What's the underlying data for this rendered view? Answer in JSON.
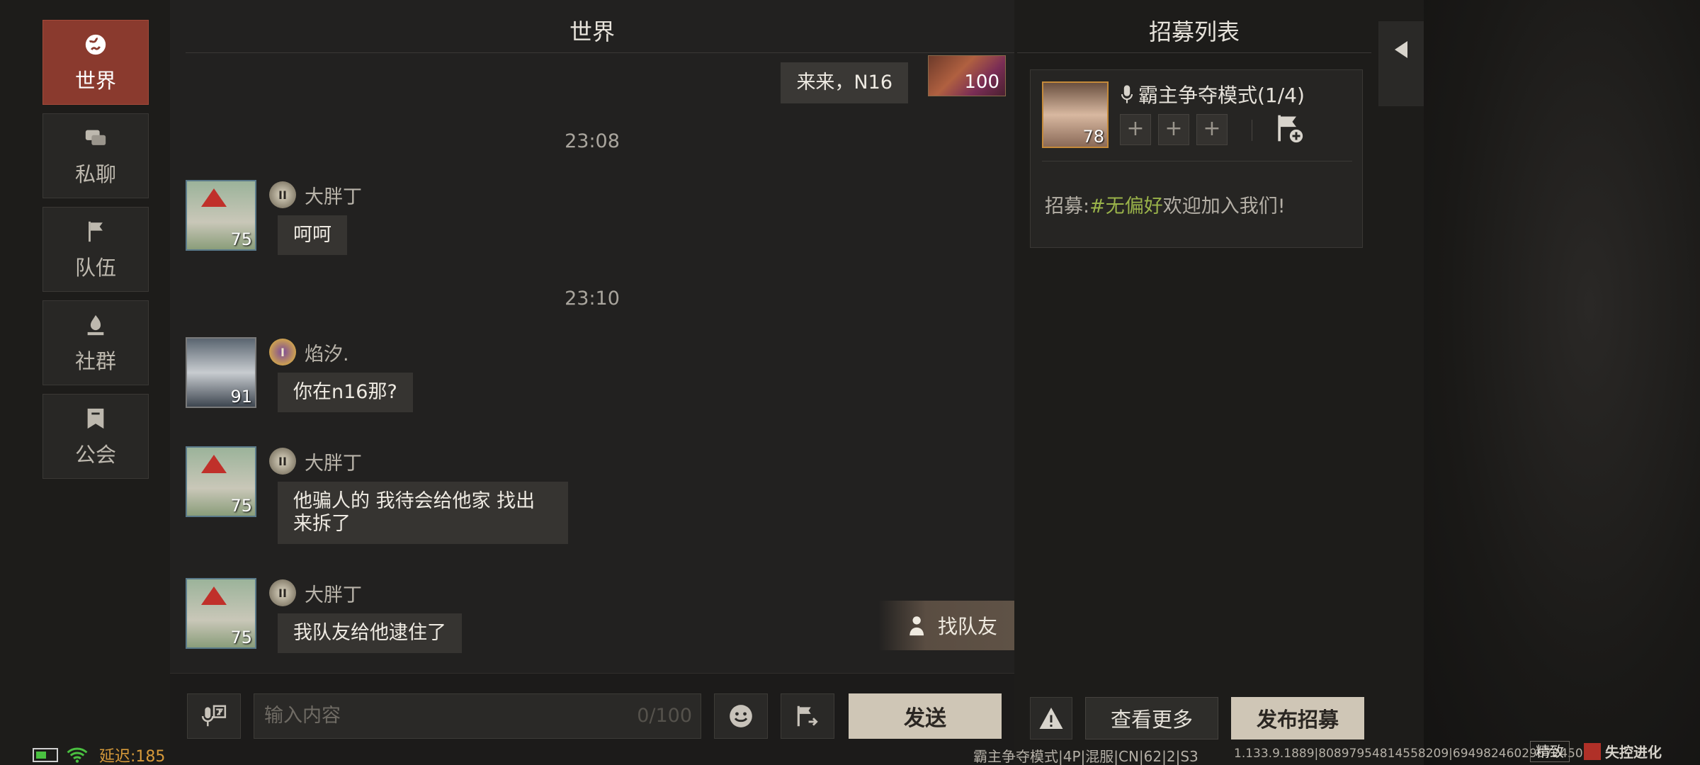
{
  "sidebar": {
    "items": [
      {
        "label": "世界",
        "icon": "globe-icon",
        "active": true
      },
      {
        "label": "私聊",
        "icon": "chat-bubbles-icon",
        "active": false
      },
      {
        "label": "队伍",
        "icon": "flag-icon",
        "active": false
      },
      {
        "label": "社群",
        "icon": "campfire-icon",
        "active": false
      },
      {
        "label": "公会",
        "icon": "guild-banner-icon",
        "active": false
      }
    ]
  },
  "chat": {
    "title": "世界",
    "self_message": {
      "text": "来来，N16",
      "level": "100"
    },
    "times": [
      "23:08",
      "23:10"
    ],
    "messages": [
      {
        "name": "大胖丁",
        "rank": "II",
        "level": "75",
        "text": "呵呵"
      },
      {
        "name": "焰汐.",
        "rank": "I",
        "level": "91",
        "text": "你在n16那?"
      },
      {
        "name": "大胖丁",
        "rank": "II",
        "level": "75",
        "text": "他骗人的 我待会给他家 找出来拆了"
      },
      {
        "name": "大胖丁",
        "rank": "II",
        "level": "75",
        "text": "我队友给他逮住了"
      }
    ],
    "find_team_label": "找队友",
    "input": {
      "placeholder": "输入内容",
      "count": "0/100"
    },
    "send_label": "发送"
  },
  "recruit": {
    "title": "招募列表",
    "card": {
      "mode": "霸主争夺模式(1/4)",
      "level": "78",
      "slots": [
        "+",
        "+",
        "+"
      ],
      "text_prefix": "招募:",
      "text_tag": "#无偏好",
      "text_suffix": "欢迎加入我们!"
    },
    "more_label": "查看更多",
    "post_label": "发布招募"
  },
  "status": {
    "latency": "延迟:185",
    "server": "霸主争夺模式|4P|混服|CN|62|2|S3",
    "version": "1.133.9.1889|80897954814558209|69498246029672450",
    "quality": "精致",
    "logo": "失控进化"
  },
  "colors": {
    "accent_active": "#8a3a2e",
    "tag_green": "#9ab34a",
    "latency_orange": "#d79a3a"
  }
}
